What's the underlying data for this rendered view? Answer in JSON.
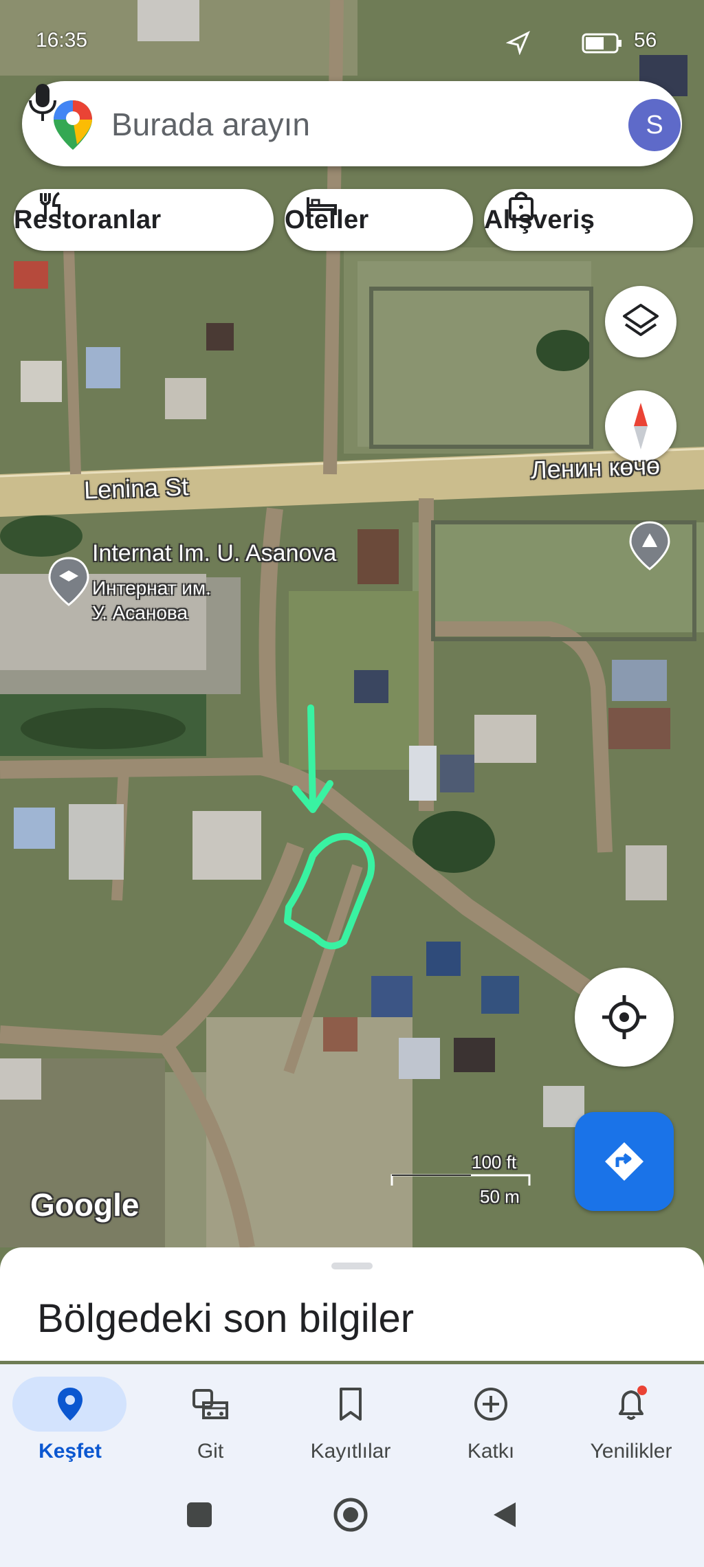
{
  "status": {
    "time": "16:35",
    "battery": "56"
  },
  "search": {
    "placeholder": "Burada arayın",
    "avatar_letter": "S"
  },
  "chips": [
    {
      "label": "Restoranlar",
      "icon": "fork-knife-icon"
    },
    {
      "label": "Oteller",
      "icon": "bed-icon"
    },
    {
      "label": "Alışveriş",
      "icon": "shopping-bag-icon"
    }
  ],
  "map": {
    "street_latin": "Lenina St",
    "street_cyrillic": "Ленин көчө",
    "poi_name": "Internat Im. U. Asanova",
    "poi_name_ru_line1": "Интернат им.",
    "poi_name_ru_line2": "У. Асанова",
    "google": "Google",
    "scale_ft": "100 ft",
    "scale_m": "50 m",
    "colors": {
      "annotation": "#39f2a2",
      "accent": "#1a73e8"
    }
  },
  "sheet": {
    "title": "Bölgedeki son bilgiler"
  },
  "nav": [
    {
      "label": "Keşfet",
      "icon": "location-pin-icon",
      "active": true
    },
    {
      "label": "Git",
      "icon": "commute-icon",
      "active": false
    },
    {
      "label": "Kayıtlılar",
      "icon": "bookmark-icon",
      "active": false
    },
    {
      "label": "Katkı",
      "icon": "add-circle-icon",
      "active": false
    },
    {
      "label": "Yenilikler",
      "icon": "bell-icon",
      "active": false
    }
  ]
}
